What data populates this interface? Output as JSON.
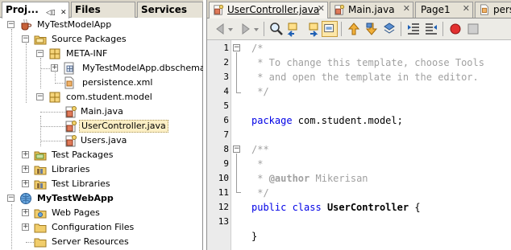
{
  "projects_panel": {
    "tabs": [
      {
        "label": "Proj..."
      },
      {
        "label": "Files"
      },
      {
        "label": "Services"
      }
    ],
    "tree": [
      {
        "label": "MyTestModelApp",
        "icon": "coffee-project-icon",
        "expander": "minus"
      },
      {
        "label": "Source Packages",
        "icon": "source-packages-icon",
        "expander": "minus"
      },
      {
        "label": "META-INF",
        "icon": "package-icon",
        "expander": "minus"
      },
      {
        "label": "MyTestModelApp.dbschema",
        "icon": "dbschema-icon",
        "expander": "plus"
      },
      {
        "label": "persistence.xml",
        "icon": "xml-file-icon",
        "expander": ""
      },
      {
        "label": "com.student.model",
        "icon": "package-icon",
        "expander": "minus"
      },
      {
        "label": "Main.java",
        "icon": "java-file-icon",
        "expander": ""
      },
      {
        "label": "UserController.java",
        "icon": "java-file-icon",
        "expander": "",
        "selected": true
      },
      {
        "label": "Users.java",
        "icon": "java-file-icon",
        "expander": ""
      },
      {
        "label": "Test Packages",
        "icon": "test-packages-icon",
        "expander": "plus"
      },
      {
        "label": "Libraries",
        "icon": "libraries-icon",
        "expander": "plus"
      },
      {
        "label": "Test Libraries",
        "icon": "libraries-icon",
        "expander": "plus"
      },
      {
        "label": "MyTestWebApp",
        "icon": "globe-project-icon",
        "expander": "minus"
      },
      {
        "label": "Web Pages",
        "icon": "folder-icon",
        "expander": "plus"
      },
      {
        "label": "Configuration Files",
        "icon": "folder-icon",
        "expander": "plus"
      },
      {
        "label": "Server Resources",
        "icon": "folder-icon",
        "expander": ""
      }
    ]
  },
  "editor": {
    "tabs": [
      {
        "label": "UserController.java",
        "active": true
      },
      {
        "label": "Main.java"
      },
      {
        "label": "Page1"
      },
      {
        "label": "persiste"
      }
    ],
    "toolbar_buttons": [
      "back-icon",
      "back-dropdown-icon",
      "forward-icon",
      "forward-dropdown-icon",
      "find-icon",
      "find-previous-icon",
      "find-next-icon",
      "find-selection-icon",
      "toggle-highlight-icon",
      "previous-bookmark-icon",
      "next-bookmark-icon",
      "toggle-bookmark-icon",
      "shift-left-icon",
      "shift-right-icon",
      "record-macro-icon",
      "stop-macro-icon"
    ],
    "line_numbers": [
      "1",
      "2",
      "3",
      "4",
      "5",
      "6",
      "7",
      "8",
      "9",
      "10",
      "11",
      "12",
      "13"
    ],
    "code": {
      "l1": "/*",
      "l2": " * To change this template, choose Tools",
      "l3": " * and open the template in the editor.",
      "l4": " */",
      "l6_kw": "package",
      "l6_rest": " com.student.model;",
      "l8": "/**",
      "l9": " *",
      "l10_pre": " * ",
      "l10_tag": "@author",
      "l10_rest": " Mikerisan",
      "l11": " */",
      "l12_kw": "public class",
      "l12_sp": " ",
      "l12_name": "UserController",
      "l12_rest": " {",
      "l14": "}"
    }
  }
}
